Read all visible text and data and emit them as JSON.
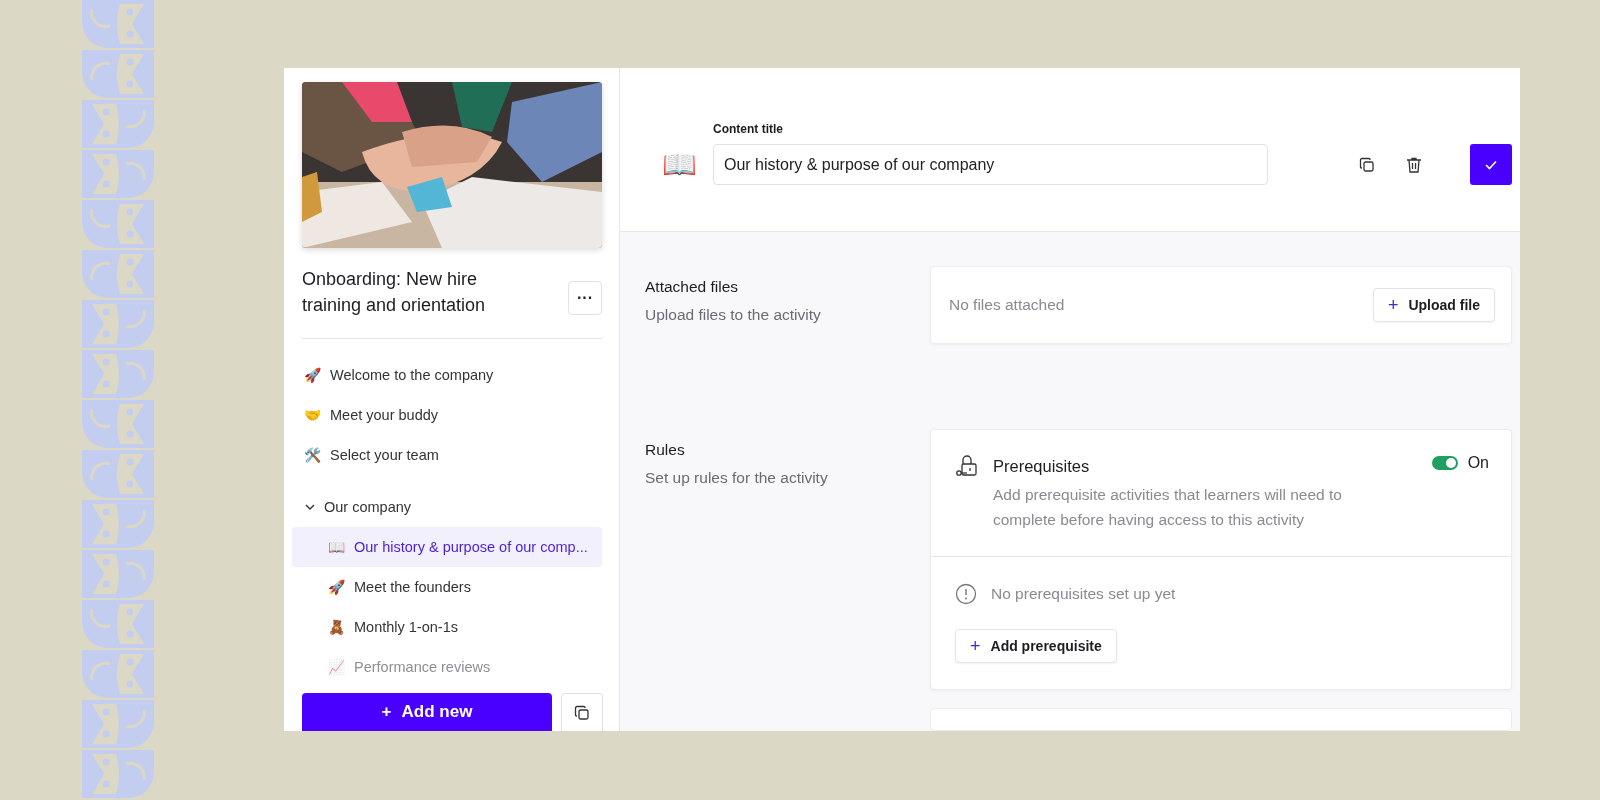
{
  "sidebar": {
    "course_title": "Onboarding: New hire training and orientation",
    "more_button": "···",
    "items": [
      {
        "emoji": "🚀",
        "label": "Welcome to the company",
        "selected": false
      },
      {
        "emoji": "🤝",
        "label": "Meet your buddy",
        "selected": false
      },
      {
        "emoji": "🛠️",
        "label": "Select your team",
        "selected": false
      },
      {
        "label": "Our company",
        "expanded": true,
        "selected": false,
        "children": [
          {
            "emoji": "📖",
            "label": "Our history & purpose of our comp...",
            "selected": true
          },
          {
            "emoji": "🚀",
            "label": "Meet the founders",
            "selected": false
          },
          {
            "emoji": "🧸",
            "label": "Monthly 1-on-1s",
            "selected": false
          },
          {
            "emoji": "📈",
            "label": "Performance reviews",
            "selected": false,
            "faded": true
          }
        ]
      }
    ],
    "add_button": {
      "icon": "+",
      "label": "Add new"
    }
  },
  "header": {
    "icon": "📖",
    "field_label": "Content title",
    "title_value": "Our history & purpose of our company"
  },
  "sections": [
    {
      "kind": "files",
      "title": "Attached files",
      "subtitle": "Upload files to the activity",
      "empty_text": "No files attached",
      "button": {
        "icon": "+",
        "label": "Upload file"
      }
    },
    {
      "kind": "rules",
      "title": "Rules",
      "subtitle": "Set up rules for the activity",
      "rule": {
        "title": "Prerequisites",
        "description": "Add prerequisite activities that learners will need to complete before having access to this activity",
        "on": true,
        "toggle_label": "On",
        "empty_text": "No prerequisites set up yet",
        "button": {
          "icon": "+",
          "label": "Add prerequisite"
        }
      }
    }
  ]
}
